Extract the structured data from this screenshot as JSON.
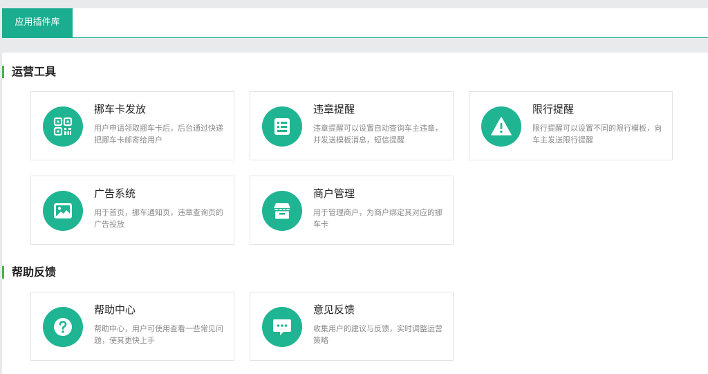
{
  "tab": {
    "label": "应用插件库"
  },
  "sections": [
    {
      "title": "运营工具",
      "cards": [
        {
          "title": "挪车卡发放",
          "desc": "用户申请领取挪车卡后，后台通过快递把挪车卡邮寄给用户",
          "icon": "qr-code-icon"
        },
        {
          "title": "违章提醒",
          "desc": "违章提醒可以设置自动查询车主违章，并发送模板消息，短信提醒",
          "icon": "notice-list-icon"
        },
        {
          "title": "限行提醒",
          "desc": "限行提醒可以设置不同的限行模板，向车主发送限行提醒",
          "icon": "warning-icon"
        },
        {
          "title": "广告系统",
          "desc": "用于首页，挪车通知页，违章查询页的广告投放",
          "icon": "image-icon"
        },
        {
          "title": "商户管理",
          "desc": "用于管理商户，为商户绑定其对应的挪车卡",
          "icon": "store-icon"
        }
      ]
    },
    {
      "title": "帮助反馈",
      "cards": [
        {
          "title": "帮助中心",
          "desc": "帮助中心，用户可使用查看一些常见问题，使其更快上手",
          "icon": "question-icon"
        },
        {
          "title": "意见反馈",
          "desc": "收集用户的建议与反馈，实时调整运营策略",
          "icon": "chat-bubble-icon"
        }
      ]
    }
  ],
  "colors": {
    "accent": "#1aad8f",
    "icon_bg": "#1fb592",
    "section_bar": "#4caf50"
  }
}
